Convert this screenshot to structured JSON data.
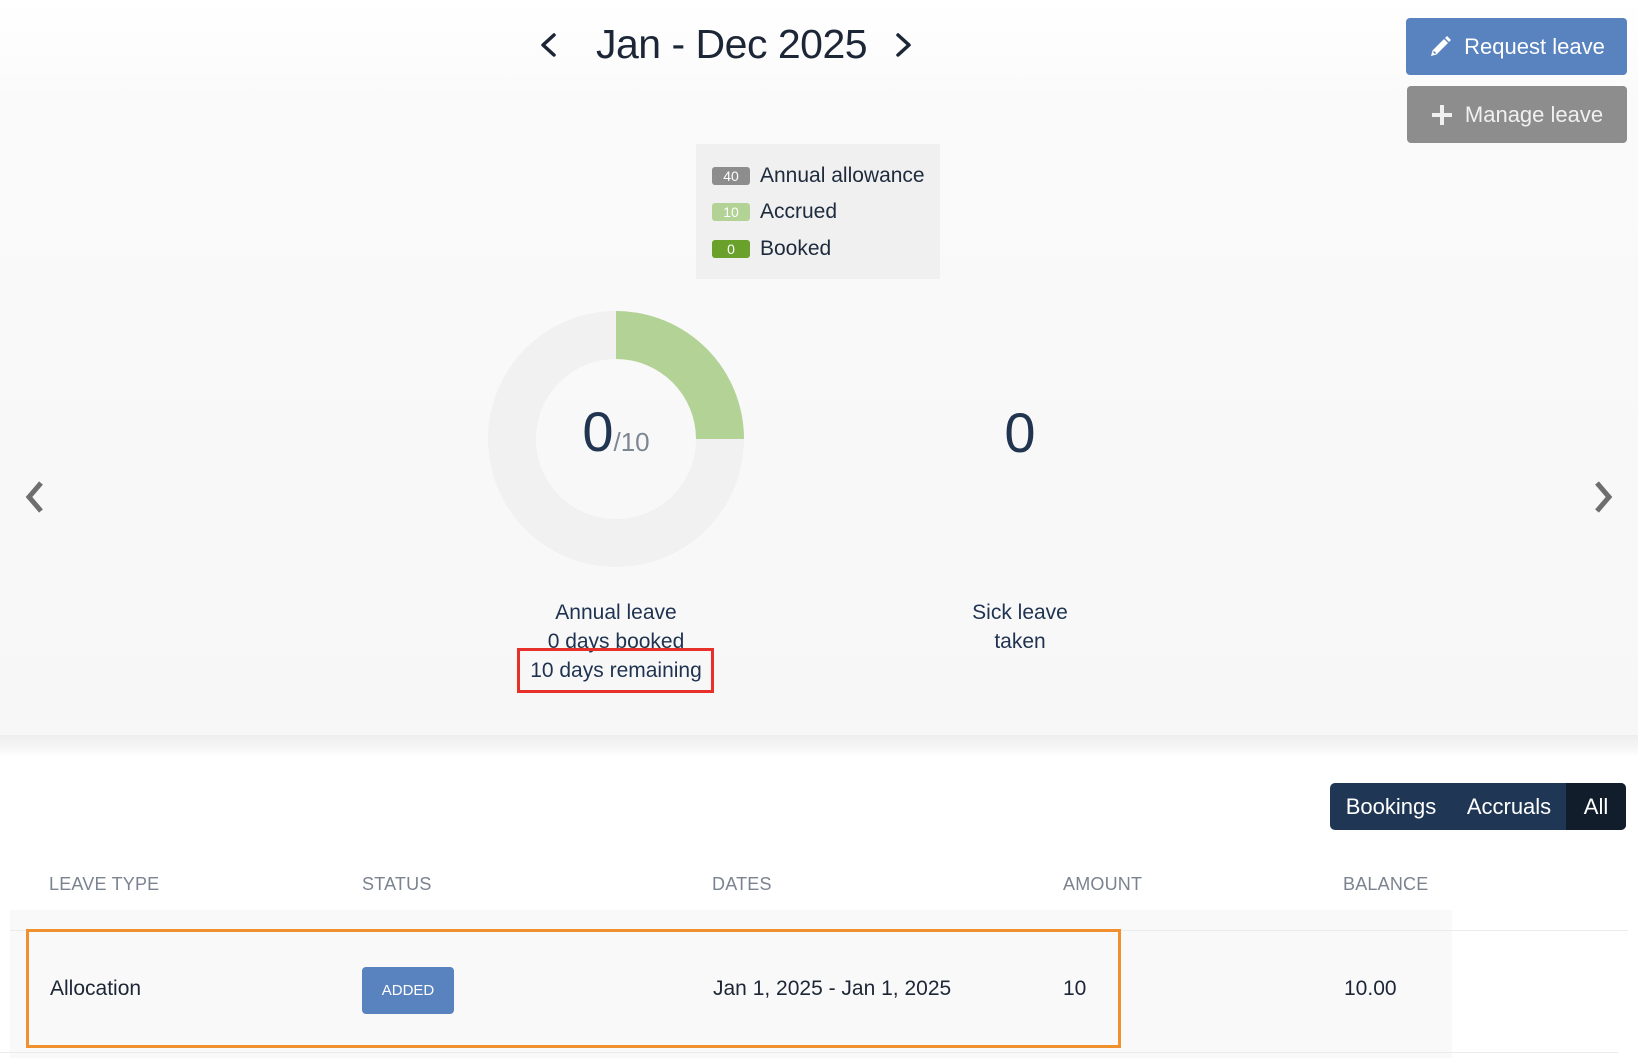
{
  "period": {
    "title": "Jan - Dec 2025",
    "prev_icon": "chevron-left-icon",
    "next_icon": "chevron-right-icon"
  },
  "actions": {
    "request_label": "Request leave",
    "request_icon": "pencil-icon",
    "manage_label": "Manage leave",
    "manage_icon": "plus-icon"
  },
  "legend": {
    "items": [
      {
        "count": "40",
        "label": "Annual allowance",
        "color": "#8d8d8d"
      },
      {
        "count": "10",
        "label": "Accrued",
        "color": "#b3d296"
      },
      {
        "count": "0",
        "label": "Booked",
        "color": "#6aa12a"
      }
    ]
  },
  "annual_leave": {
    "booked_value": "0",
    "total_value": "/10",
    "accrued_fraction": 0.25,
    "booked_fraction": 0,
    "title": "Annual leave",
    "booked_text": "0 days booked",
    "remaining_text": "10 days remaining"
  },
  "sick_leave": {
    "count": "0",
    "line1": "Sick leave",
    "line2": "taken"
  },
  "carousel": {
    "prev_icon": "chevron-left-icon",
    "next_icon": "chevron-right-icon"
  },
  "filters": {
    "tabs": [
      "Bookings",
      "Accruals",
      "All"
    ],
    "active": "All"
  },
  "table": {
    "headers": [
      "LEAVE TYPE",
      "STATUS",
      "DATES",
      "AMOUNT",
      "BALANCE"
    ],
    "rows": [
      {
        "leave_type": "Allocation",
        "status": "ADDED",
        "dates": "Jan 1, 2025 - Jan 1, 2025",
        "amount": "10",
        "balance": "10.00"
      }
    ]
  },
  "colors": {
    "primary": "#5983bf",
    "navy": "#1f3654",
    "accrued": "#b3d296",
    "booked": "#6aa12a",
    "highlight_red": "#e8302a",
    "highlight_orange": "#f0902f"
  }
}
